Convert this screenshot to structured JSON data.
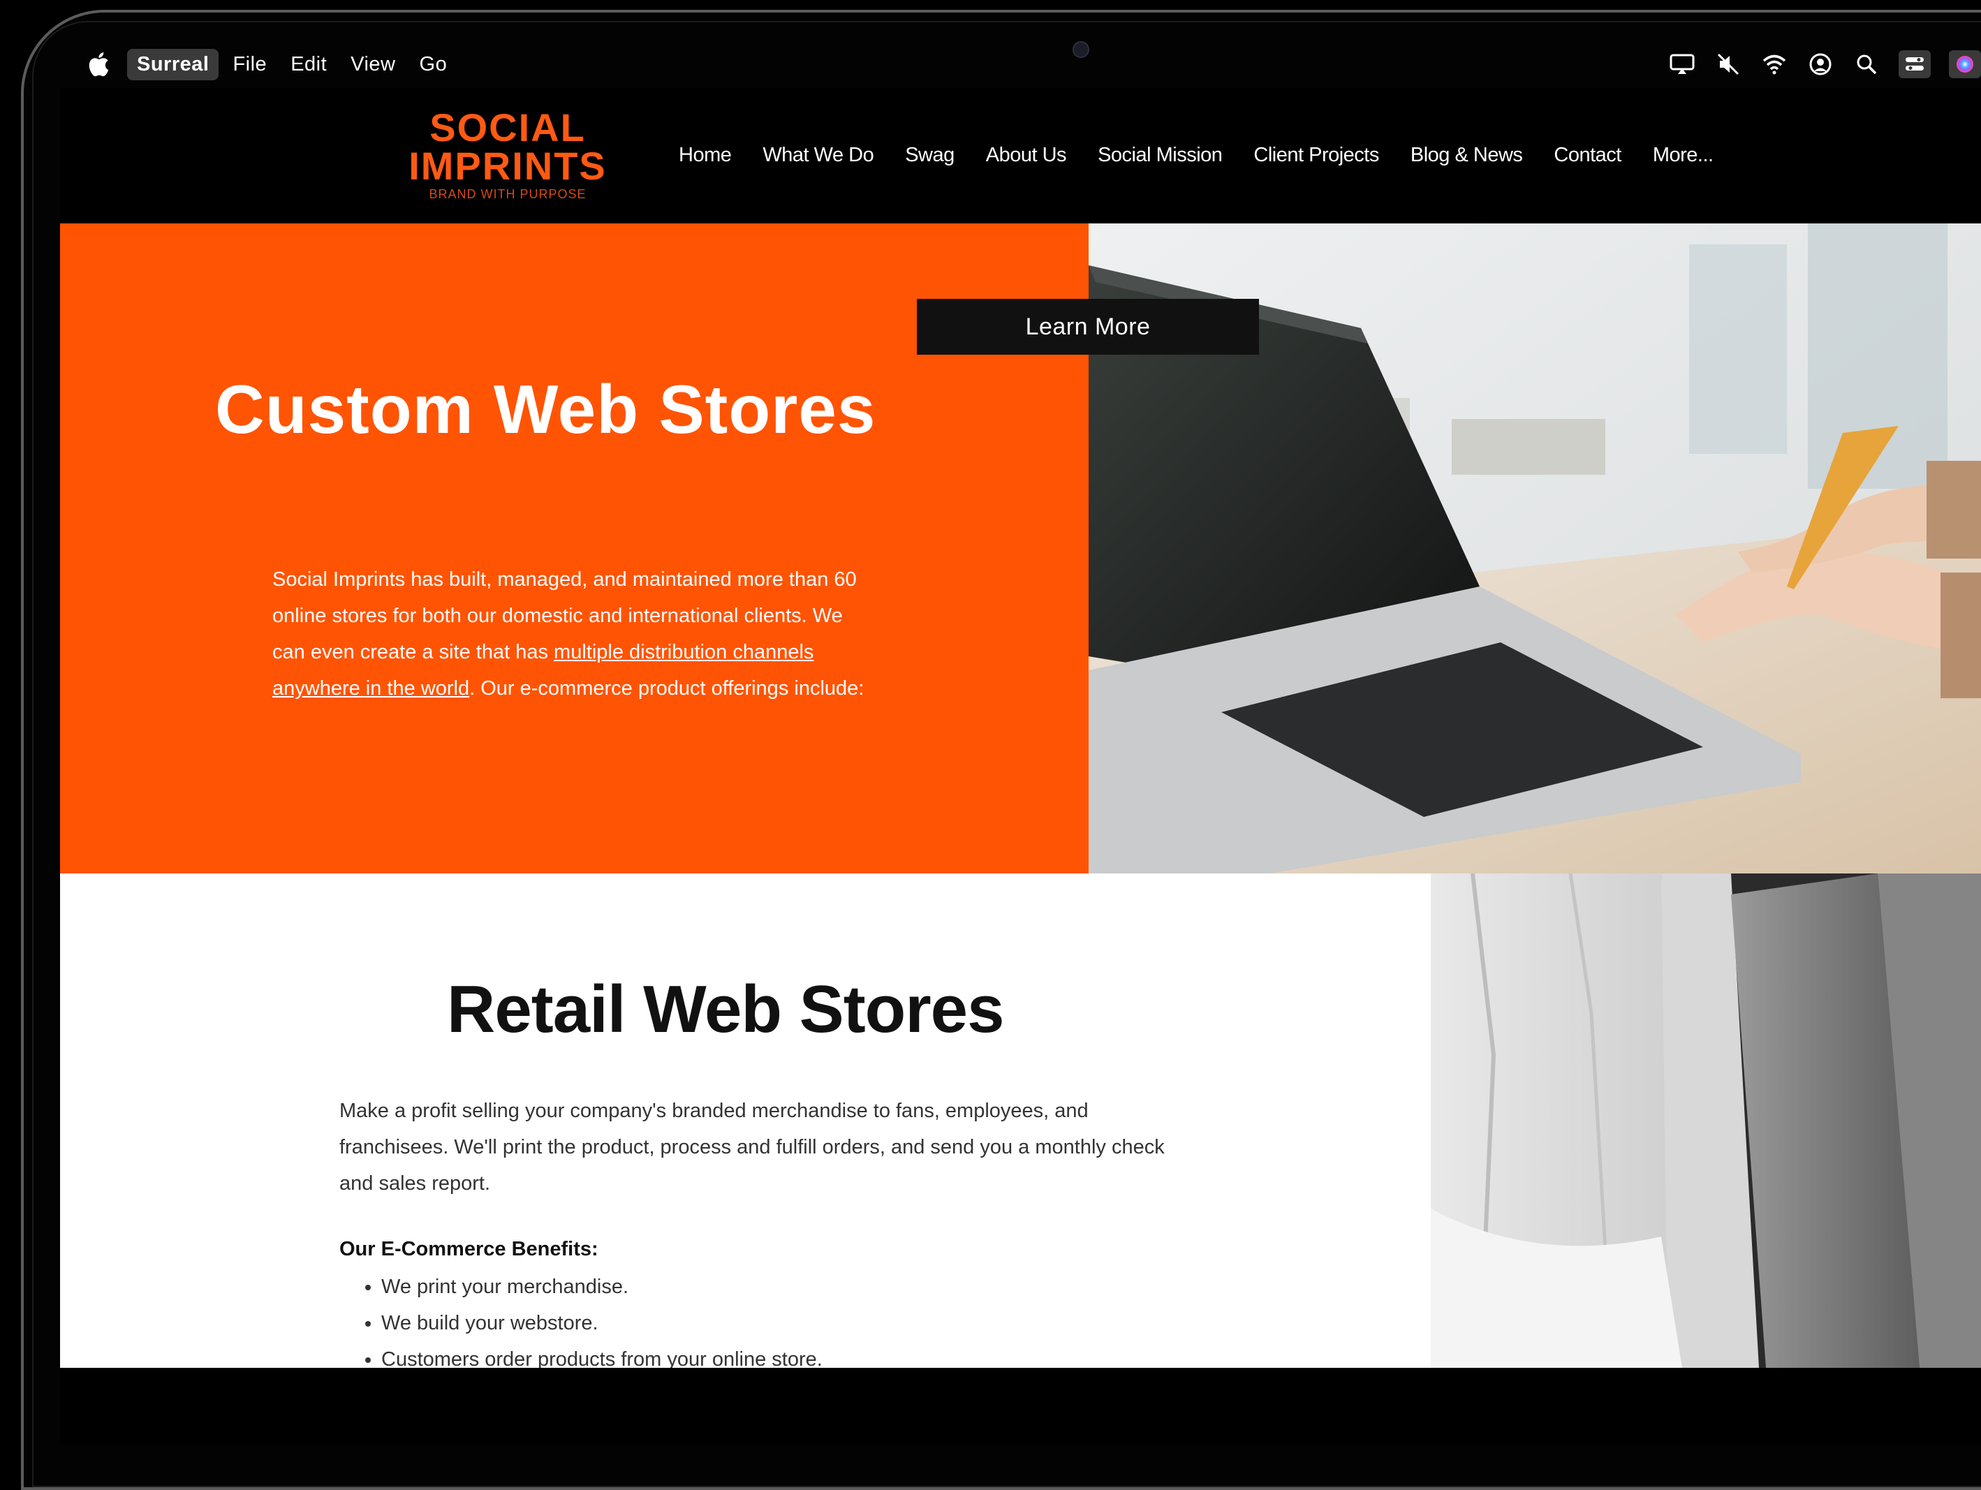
{
  "menubar": {
    "app_name": "Surreal",
    "items": [
      "File",
      "Edit",
      "View",
      "Go"
    ],
    "status_icons": [
      "display-icon",
      "mute-icon",
      "wifi-icon",
      "user-icon",
      "search-icon",
      "control-center-icon",
      "siri-icon"
    ]
  },
  "site": {
    "logo": {
      "line1": "SOCIAL",
      "line2": "IMPRINTS",
      "tagline": "BRAND WITH PURPOSE"
    },
    "nav": [
      "Home",
      "What We Do",
      "Swag",
      "About Us",
      "Social Mission",
      "Client Projects",
      "Blog & News",
      "Contact",
      "More..."
    ],
    "hero": {
      "title": "Custom Web Stores",
      "text_before": "Social Imprints has built, managed, and maintained more than 60 online stores for both our domestic and international clients. We can even create a site that has ",
      "link": "multiple distribution channels anywhere in the world",
      "text_after": ". Our e-commerce product offerings include:",
      "button": "Learn More"
    },
    "retail": {
      "title": "Retail Web Stores",
      "text": "Make a profit selling your company's branded merchandise to fans, employees, and franchisees. We'll print the product, process and fulfill orders, and send you a monthly check and sales report.",
      "benefits_title": "Our E-Commerce Benefits:",
      "benefits": [
        "We print your merchandise.",
        "We build your webstore.",
        "Customers order products from your online store."
      ]
    }
  },
  "colors": {
    "brand_orange": "#ff5404",
    "logo_orange": "#ff5a14"
  }
}
